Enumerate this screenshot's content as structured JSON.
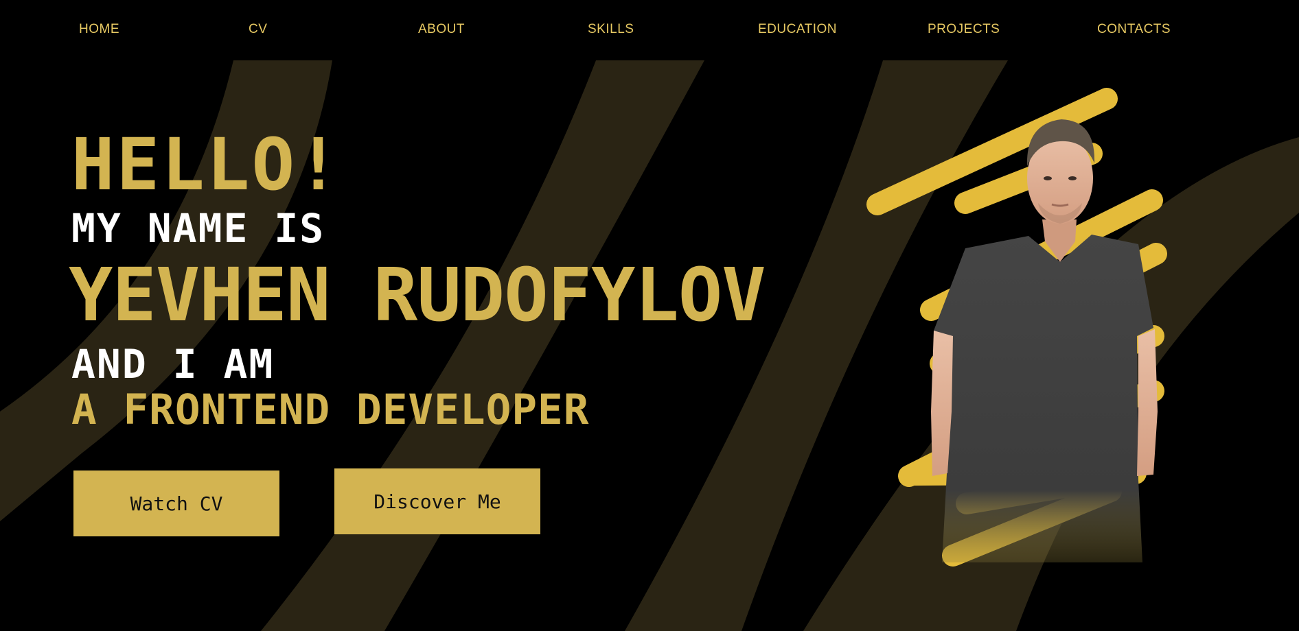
{
  "nav": {
    "items": [
      {
        "label": "HOME"
      },
      {
        "label": "CV"
      },
      {
        "label": "ABOUT"
      },
      {
        "label": "SKILLS"
      },
      {
        "label": "EDUCATION"
      },
      {
        "label": "PROJECTS"
      },
      {
        "label": "CONTACTS"
      }
    ]
  },
  "hero": {
    "greeting": "HELLO!",
    "intro": "MY NAME IS",
    "name": "YEVHEN RUDOFYLOV",
    "connector": "AND I AM",
    "role": "A FRONTEND DEVELOPER"
  },
  "buttons": {
    "watch_cv": "Watch CV",
    "discover": "Discover Me"
  },
  "colors": {
    "background": "#000000",
    "accent": "#d3b451",
    "stripe": "#2a2414",
    "scribble": "#e4bb3a",
    "text_light": "#ffffff",
    "nav_text": "#e7c963"
  },
  "images": {
    "portrait": "portrait-photo"
  }
}
